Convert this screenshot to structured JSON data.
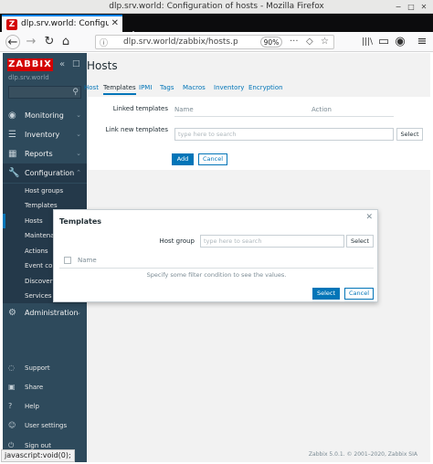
{
  "window": {
    "title": "dlp.srv.world: Configuration of hosts - Mozilla Firefox",
    "controls": [
      "−",
      "□",
      "✕"
    ]
  },
  "browser": {
    "tab_label": "dlp.srv.world: Configurati",
    "tab_close": "✕",
    "new_tab": "+",
    "back": "←",
    "forward": "→",
    "reload": "↻",
    "home": "⌂",
    "url": "dlp.srv.world/zabbix/hosts.php?",
    "zoom": "90%",
    "more": "···",
    "pocket": "◇",
    "bookmark": "☆",
    "library": "|||\\",
    "reader": "▭",
    "account": "◉",
    "hamburger": "≡"
  },
  "sidebar": {
    "logo": "ZABBIX",
    "collapse": "«",
    "expand": "□",
    "server": "dlp.srv.world",
    "search_icon": "⚲",
    "menu": [
      {
        "label": "Monitoring",
        "icon": "◉",
        "chev": "⌄"
      },
      {
        "label": "Inventory",
        "icon": "☰",
        "chev": "⌄"
      },
      {
        "label": "Reports",
        "icon": "▦",
        "chev": "⌄"
      },
      {
        "label": "Configuration",
        "icon": "🔧",
        "chev": "⌃"
      },
      {
        "label": "Administration",
        "icon": "⚙",
        "chev": "⌄"
      }
    ],
    "submenu": [
      "Host groups",
      "Templates",
      "Hosts",
      "Maintenance",
      "Actions",
      "Event correlation",
      "Discovery",
      "Services"
    ],
    "bottom": [
      {
        "label": "Support",
        "icon": "◌"
      },
      {
        "label": "Share",
        "icon": "▣"
      },
      {
        "label": "Help",
        "icon": "?"
      },
      {
        "label": "User settings",
        "icon": "☺"
      },
      {
        "label": "Sign out",
        "icon": "⏻"
      }
    ]
  },
  "main": {
    "title": "Hosts",
    "tabs": [
      "Host",
      "Templates",
      "IPMI",
      "Tags",
      "Macros",
      "Inventory",
      "Encryption"
    ],
    "form": {
      "linked_label": "Linked templates",
      "col_name": "Name",
      "col_action": "Action",
      "link_new_label": "Link new templates",
      "search_placeholder": "type here to search",
      "select_label": "Select",
      "add_label": "Add",
      "cancel_label": "Cancel"
    },
    "footer": "Zabbix 5.0.1. © 2001–2020, Zabbix SIA"
  },
  "modal": {
    "title": "Templates",
    "close": "✕",
    "host_group_label": "Host group",
    "search_placeholder": "type here to search",
    "select_label": "Select",
    "col_name": "Name",
    "empty_text": "Specify some filter condition to see the values.",
    "select_button": "Select",
    "cancel_button": "Cancel"
  },
  "status_bar": "javascript:void(0);"
}
